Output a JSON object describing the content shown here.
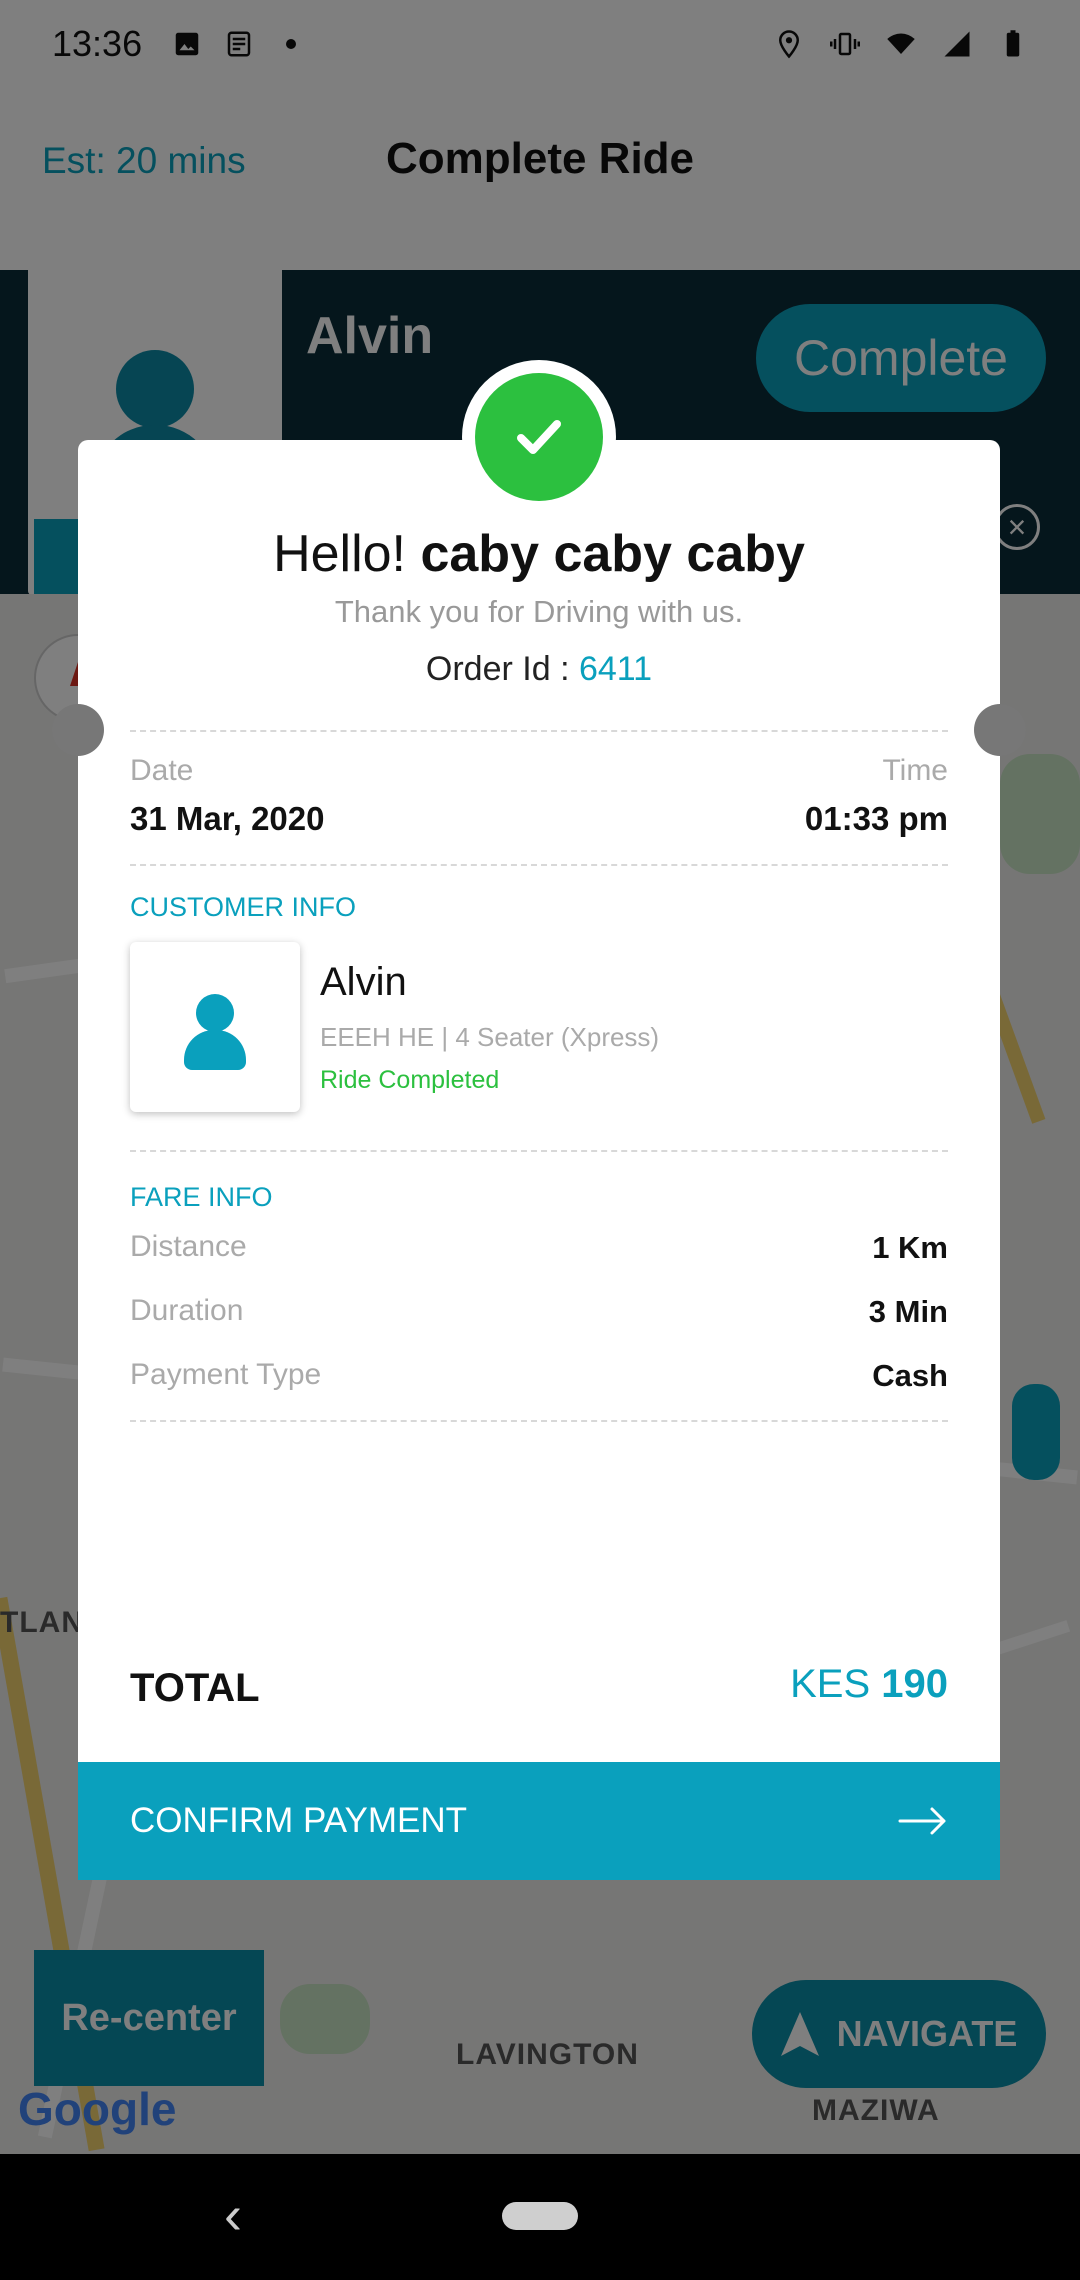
{
  "status_bar": {
    "time": "13:36"
  },
  "header": {
    "estimate": "Est: 20 mins",
    "title": "Complete Ride"
  },
  "driver_panel": {
    "name": "Alvin",
    "complete_label": "Complete"
  },
  "map": {
    "labels": [
      "LAVINGTON",
      "MAZIWA",
      "TLAND"
    ],
    "recenter_label": "Re-center",
    "navigate_label": "NAVIGATE",
    "logo": "Google"
  },
  "dialog": {
    "greeting": "Hello!",
    "user_name": "caby caby caby",
    "thanks": "Thank you for Driving with us.",
    "order_label": "Order Id :",
    "order_id": "6411",
    "date_label": "Date",
    "date_value": "31 Mar, 2020",
    "time_label": "Time",
    "time_value": "01:33 pm",
    "customer_section": "CUSTOMER INFO",
    "customer": {
      "name": "Alvin",
      "vehicle": "EEEH HE | 4 Seater (Xpress)",
      "status": "Ride Completed"
    },
    "fare_section": "FARE INFO",
    "fare": [
      {
        "label": "Distance",
        "value": "1 Km"
      },
      {
        "label": "Duration",
        "value": "3 Min"
      },
      {
        "label": "Payment Type",
        "value": "Cash"
      }
    ],
    "total_label": "TOTAL",
    "currency": "KES",
    "total_amount": "190",
    "confirm_label": "CONFIRM PAYMENT"
  },
  "colors": {
    "accent": "#0aa0bd",
    "success": "#2cc03f",
    "panel": "#0b2d38"
  }
}
